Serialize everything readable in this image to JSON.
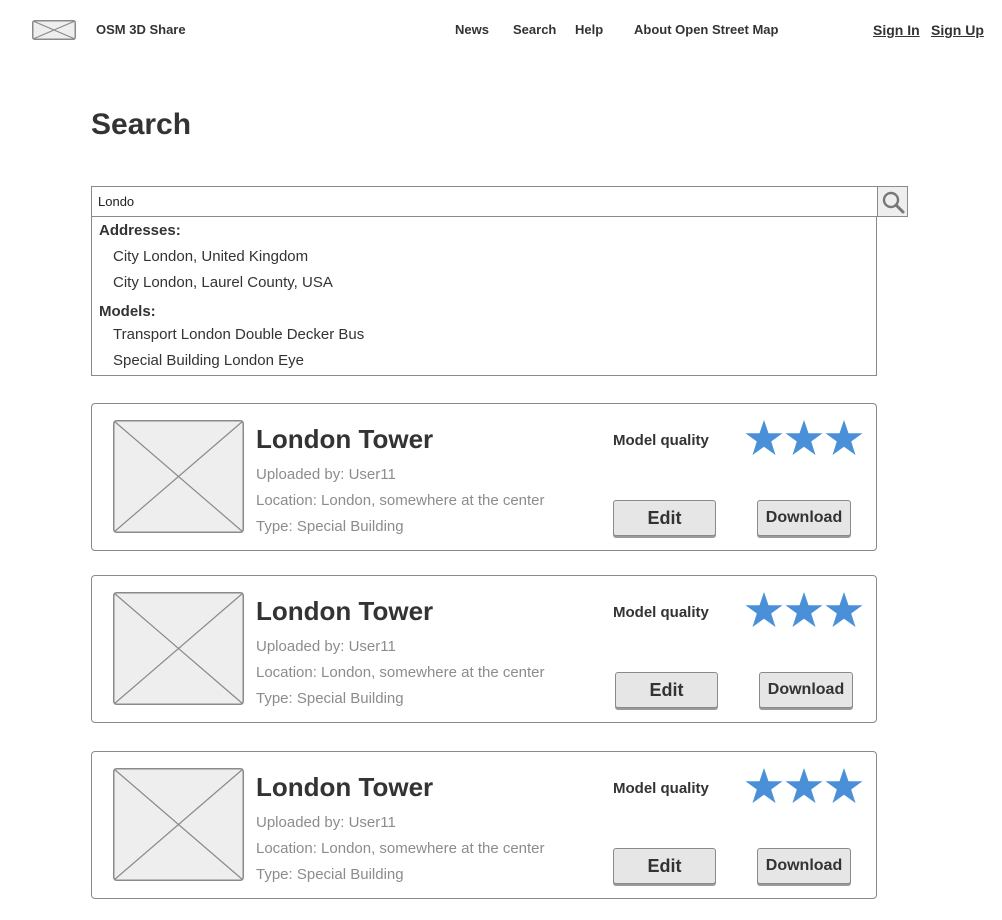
{
  "header": {
    "brand": "OSM 3D Share",
    "nav": [
      "News",
      "Search",
      "Help",
      "About Open Street Map"
    ],
    "sign_in": "Sign In",
    "sign_up": "Sign Up"
  },
  "page": {
    "title": "Search"
  },
  "search": {
    "value": "Londo",
    "suggestions": {
      "addresses_label": "Addresses:",
      "addresses": [
        "City London, United Kingdom",
        "City London, Laurel County, USA"
      ],
      "models_label": "Models:",
      "models": [
        "Transport London Double Decker Bus",
        "Special Building London Eye"
      ]
    }
  },
  "results": [
    {
      "title": "London Tower",
      "uploaded_by": "Uploaded by: User11",
      "location": "Location: London, somewhere at the center",
      "type": "Type: Special Building",
      "quality_label": "Model quality",
      "quality_stars": 3,
      "edit_label": "Edit",
      "download_label": "Download"
    },
    {
      "title": "London Tower",
      "uploaded_by": "Uploaded by: User11",
      "location": "Location: London, somewhere at the center",
      "type": "Type: Special Building",
      "quality_label": "Model quality",
      "quality_stars": 3,
      "edit_label": "Edit",
      "download_label": "Download"
    },
    {
      "title": "London Tower",
      "uploaded_by": "Uploaded by: User11",
      "location": "Location: London, somewhere at the center",
      "type": "Type: Special Building",
      "quality_label": "Model quality",
      "quality_stars": 3,
      "edit_label": "Edit",
      "download_label": "Download"
    }
  ],
  "colors": {
    "star": "#4a90d9",
    "border": "#8a8a8a",
    "placeholder_fill": "#eeeeee"
  }
}
